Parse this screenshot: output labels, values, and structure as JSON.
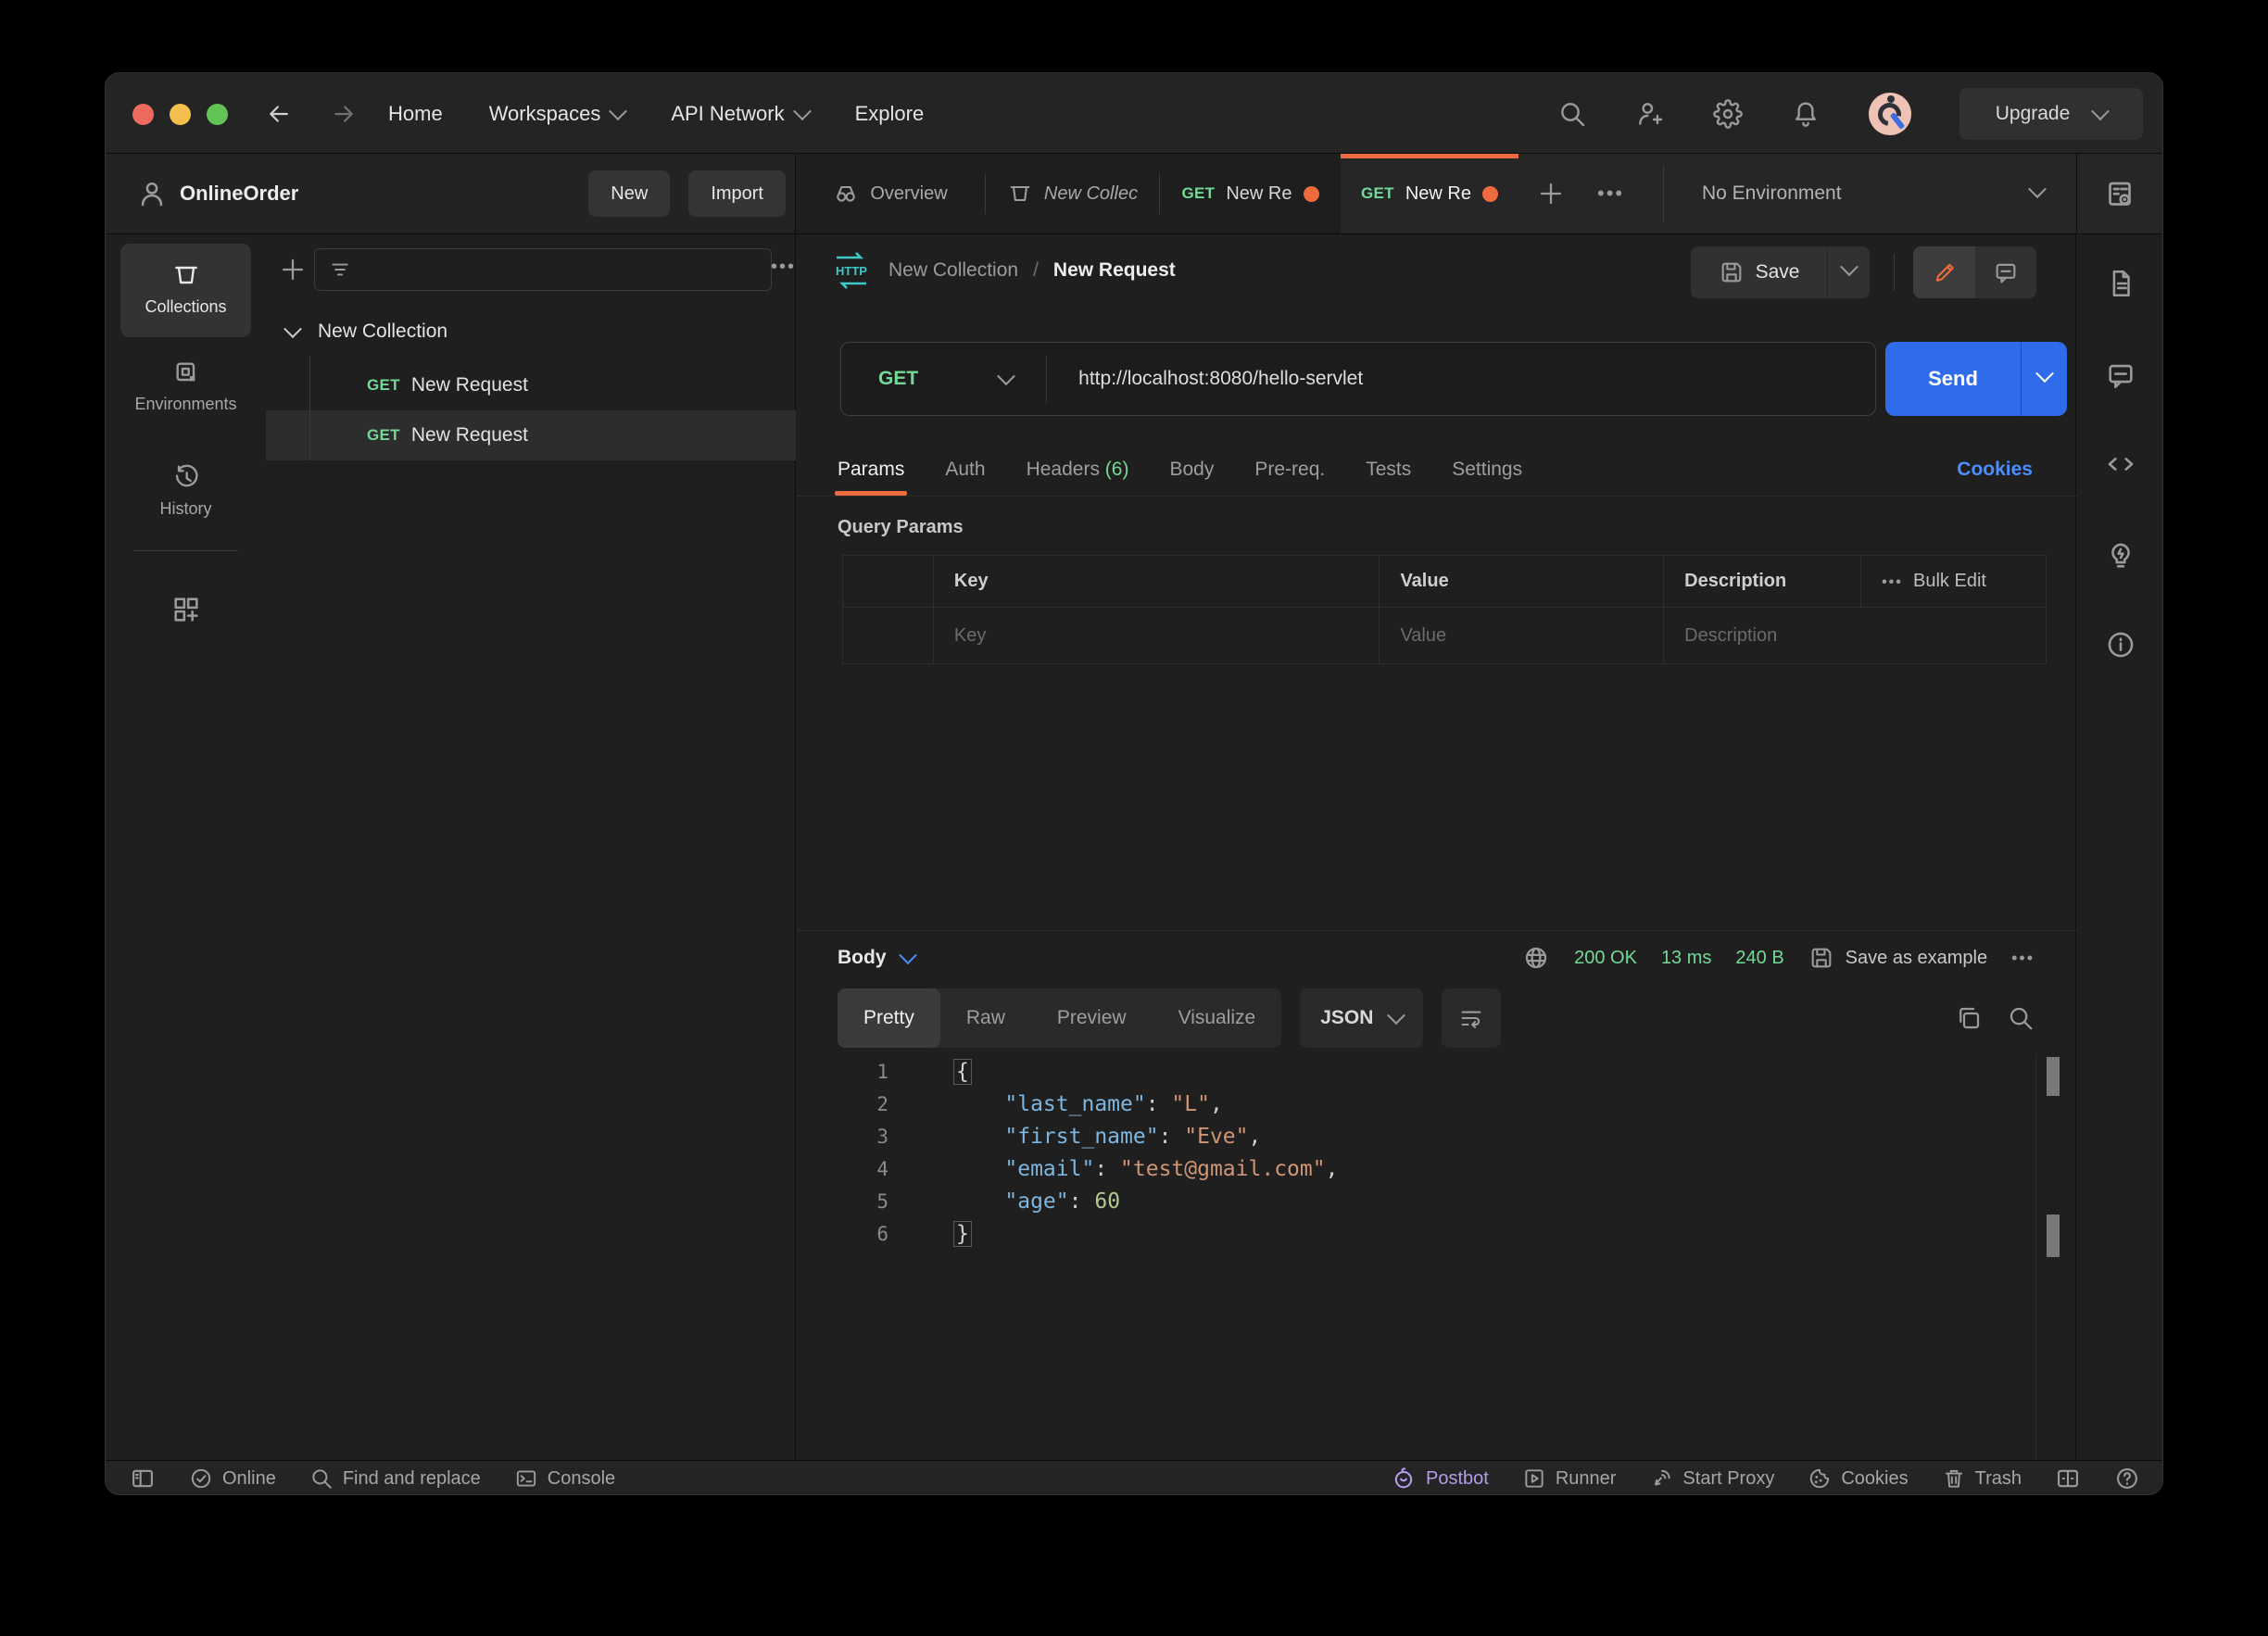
{
  "window": {
    "nav": {
      "home": "Home",
      "workspaces": "Workspaces",
      "api_network": "API Network",
      "explore": "Explore",
      "upgrade": "Upgrade"
    },
    "workspace": {
      "name": "OnlineOrder",
      "new_btn": "New",
      "import_btn": "Import"
    },
    "tabs": {
      "overview": "Overview",
      "collection": "New Collec",
      "req1_method": "GET",
      "req1_label": "New Re",
      "req2_method": "GET",
      "req2_label": "New Re",
      "environment": "No Environment"
    }
  },
  "sidebar": {
    "collections": "Collections",
    "environments": "Environments",
    "history": "History"
  },
  "tree": {
    "collection": "New Collection",
    "req1_method": "GET",
    "req1_label": "New Request",
    "req2_method": "GET",
    "req2_label": "New Request"
  },
  "request": {
    "breadcrumb_collection": "New Collection",
    "breadcrumb_sep": "/",
    "breadcrumb_request": "New Request",
    "save": "Save",
    "method": "GET",
    "url": "http://localhost:8080/hello-servlet",
    "send": "Send",
    "tabs": {
      "params": "Params",
      "auth": "Auth",
      "headers": "Headers",
      "headers_count": "(6)",
      "body": "Body",
      "prereq": "Pre-req.",
      "tests": "Tests",
      "settings": "Settings"
    },
    "cookies": "Cookies",
    "query_params_title": "Query Params",
    "table": {
      "col_key": "Key",
      "col_value": "Value",
      "col_description": "Description",
      "bulk_edit": "Bulk Edit",
      "ph_key": "Key",
      "ph_value": "Value",
      "ph_description": "Description"
    }
  },
  "response": {
    "body_label": "Body",
    "status": "200 OK",
    "time": "13 ms",
    "size": "240 B",
    "save_as_example": "Save as example",
    "views": {
      "pretty": "Pretty",
      "raw": "Raw",
      "preview": "Preview",
      "visualize": "Visualize"
    },
    "format": "JSON",
    "code_lines": [
      {
        "num": "1",
        "tokens": [
          {
            "c": "brace",
            "t": "{"
          }
        ]
      },
      {
        "num": "2",
        "tokens": [
          {
            "c": "indent",
            "t": "    "
          },
          {
            "c": "key",
            "t": "\"last_name\""
          },
          {
            "c": "punc",
            "t": ": "
          },
          {
            "c": "str",
            "t": "\"L\""
          },
          {
            "c": "punc",
            "t": ","
          }
        ]
      },
      {
        "num": "3",
        "tokens": [
          {
            "c": "indent",
            "t": "    "
          },
          {
            "c": "key",
            "t": "\"first_name\""
          },
          {
            "c": "punc",
            "t": ": "
          },
          {
            "c": "str",
            "t": "\"Eve\""
          },
          {
            "c": "punc",
            "t": ","
          }
        ]
      },
      {
        "num": "4",
        "tokens": [
          {
            "c": "indent",
            "t": "    "
          },
          {
            "c": "key",
            "t": "\"email\""
          },
          {
            "c": "punc",
            "t": ": "
          },
          {
            "c": "str",
            "t": "\"test@gmail.com\""
          },
          {
            "c": "punc",
            "t": ","
          }
        ]
      },
      {
        "num": "5",
        "tokens": [
          {
            "c": "indent",
            "t": "    "
          },
          {
            "c": "key",
            "t": "\"age\""
          },
          {
            "c": "punc",
            "t": ": "
          },
          {
            "c": "num",
            "t": "60"
          }
        ]
      },
      {
        "num": "6",
        "tokens": [
          {
            "c": "brace",
            "t": "}"
          }
        ]
      }
    ]
  },
  "statusbar": {
    "online": "Online",
    "find": "Find and replace",
    "console": "Console",
    "postbot": "Postbot",
    "runner": "Runner",
    "proxy": "Start Proxy",
    "cookies": "Cookies",
    "trash": "Trash"
  },
  "colors": {
    "accent_orange": "#ee6b3d",
    "method_green": "#74d897",
    "send_blue": "#2f6ceb",
    "link_blue": "#4c8dff",
    "postbot_purple": "#b49ce8"
  }
}
